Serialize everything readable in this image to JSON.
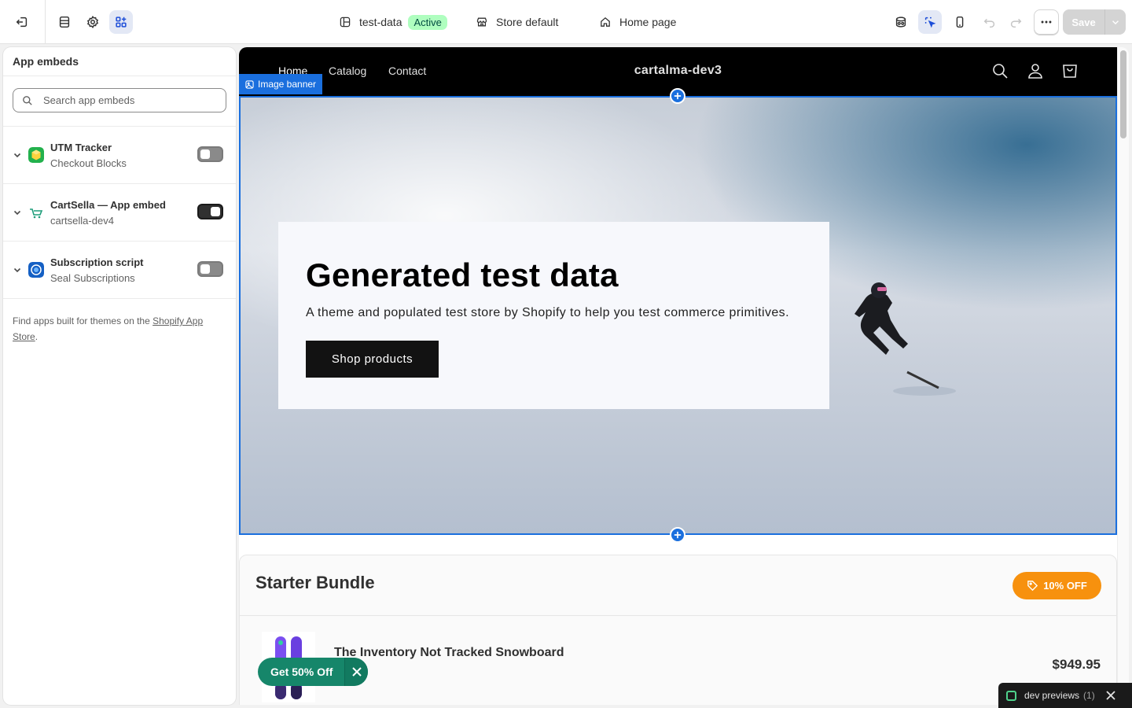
{
  "topbar": {
    "theme_name": "test-data",
    "theme_status": "Active",
    "store_context": "Store default",
    "page_selector": "Home page",
    "save_label": "Save"
  },
  "sidebar": {
    "title": "App embeds",
    "search_placeholder": "Search app embeds",
    "embeds": [
      {
        "name": "UTM Tracker",
        "app": "Checkout Blocks",
        "enabled": false
      },
      {
        "name": "CartSella — App embed",
        "app": "cartsella-dev4",
        "enabled": true
      },
      {
        "name": "Subscription script",
        "app": "Seal Subscriptions",
        "enabled": false
      }
    ],
    "footer_text": "Find apps built for themes on the ",
    "footer_link": "Shopify App Store",
    "footer_end": "."
  },
  "store": {
    "nav": [
      "Home",
      "Catalog",
      "Contact"
    ],
    "name": "cartalma-dev3",
    "section_label": "Image banner",
    "hero": {
      "title": "Generated test data",
      "text": "A theme and populated test store by Shopify to help you test commerce primitives.",
      "button": "Shop products"
    },
    "bundle": {
      "title": "Starter Bundle",
      "badge": "10% OFF",
      "product_name": "The Inventory Not Tracked Snowboard",
      "product_price": "$949.95"
    }
  },
  "promo": {
    "label": "Get 50% Off"
  },
  "dev_previews": {
    "label": "dev previews",
    "count": "(1)"
  },
  "colors": {
    "selection_blue": "#1a6fde",
    "active_badge_bg": "#affebf",
    "promo_green": "#16866a",
    "discount_orange": "#f7910e"
  }
}
